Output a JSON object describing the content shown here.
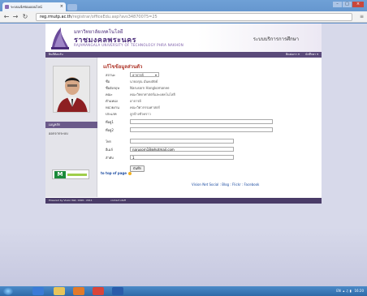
{
  "browser": {
    "tab_title": "ระบบแจ้งซ่อมออนไลน์",
    "url_domain": "reg.rmutp.ac.th",
    "url_path": "/registrar/officeEdu.asp?avs34870075=25"
  },
  "header": {
    "uni_name_small": "มหาวิทยาลัยเทคโนโลยี",
    "uni_name_big": "ราชมงคลพระนคร",
    "uni_name_en": "RAJAMANGALA UNIVERSITY OF TECHNOLOGY PHRA NAKHON",
    "system_title": "ระบบบริการการศึกษา"
  },
  "navbar": {
    "left_text": "ยินดีต้อนรับ",
    "right_items": [
      "ติดต่อเรา ▾",
      "นักศึกษา ▾"
    ]
  },
  "sidebar": {
    "user_label": "เมนูหลัก",
    "logout_label": "ออกจากระบบ"
  },
  "content": {
    "title": "แก้ไขข้อมูลส่วนตัว",
    "status_label": "สถานะ",
    "status_value": "อาจารย์",
    "name_label": "ชื่อ",
    "name_value": "นายอรุณ มั่นคงสัตย์",
    "eng_name_label": "ชื่ออังกฤษ",
    "eng_name_value": "Narusorn Hangkomanee",
    "faculty_label": "คณะ",
    "faculty_value": "คณะวิทยาศาสตร์และเทคโนโลยี",
    "position_label": "ตำแหน่ง",
    "position_value": "อาจารย์",
    "unit_label": "หน่วยงาน",
    "unit_value": "คณะวิศวกรรมศาสตร์",
    "type_label": "ประเภท",
    "type_value": "ลูกจ้างชั่วคราว",
    "phone1_label": "ที่อยู่1",
    "phone1_value": "",
    "phone2_label": "ที่อยู่2",
    "phone2_value": "",
    "tel_label": "โทร",
    "tel_value": "",
    "email_label": "อีเมล์",
    "email_value": "narusorn18@hotmail.com",
    "order_label": "ลำดับ",
    "order_value": "1",
    "save_label": "บันทึก"
  },
  "top_of_page": "to top of page",
  "social_links": "Vision Net Social : Blog : Flickr : Facebook",
  "footer": {
    "left": "Powered by Vision Net, 1999 - 2011",
    "right": "contact staff"
  },
  "taskbar": {
    "tray_text": "EN",
    "clock": "16:20"
  }
}
